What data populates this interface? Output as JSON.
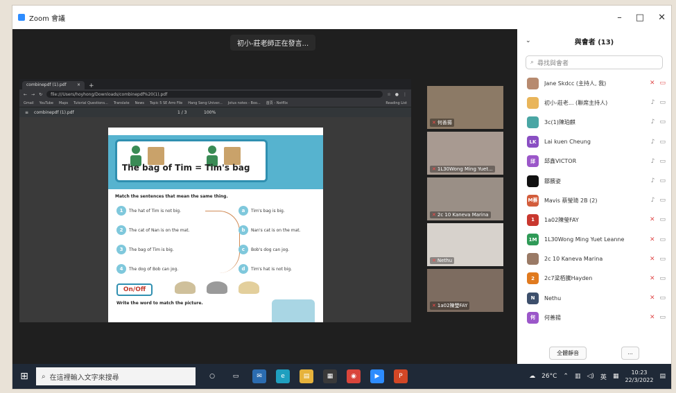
{
  "window": {
    "app_title": "Zoom 會議",
    "minimize": "–",
    "maximize": "□",
    "close": "✕"
  },
  "meeting": {
    "notice": "初小-莊老師正在發言..."
  },
  "browser": {
    "tab_title": "combinepdf (1).pdf",
    "tab_close": "×",
    "new_tab": "+",
    "url": "file:///Users/hoyhong/Downloads/combinepdf%20(1).pdf",
    "bookmarks": [
      "Gmail",
      "YouTube",
      "Maps",
      "Tutorial Questions...",
      "Translate",
      "News",
      "Topic 5 SE Arro File",
      "Hang Seng Univer...",
      "Jotus notes - Boo...",
      "首頁 - Netflix"
    ],
    "reading_list": "Reading List"
  },
  "pdf": {
    "file_name": "combinepdf (1).pdf",
    "page_indicator": "1 / 3",
    "zoom": "100%",
    "banner_title": "The bag of Tim = Tim's bag",
    "instruction": "Match the sentences that mean the same thing.",
    "left_sentences": [
      {
        "num": "1",
        "text": "The hat of Tim is not big."
      },
      {
        "num": "2",
        "text": "The cat of Nan is on the mat."
      },
      {
        "num": "3",
        "text": "The bag of Tim is big."
      },
      {
        "num": "4",
        "text": "The dog of Bob can jog."
      }
    ],
    "right_sentences": [
      {
        "num": "a",
        "text": "Tim's bag is big."
      },
      {
        "num": "b",
        "text": "Nan's cat is on the mat."
      },
      {
        "num": "c",
        "text": "Bob's dog can jog."
      },
      {
        "num": "d",
        "text": "Tim's hat is not big."
      }
    ],
    "onoff_label": "On/Off",
    "write_instruction": "Write the word to match the picture."
  },
  "video_tiles": [
    {
      "label": "何善揚",
      "bg": "#8c7a66"
    },
    {
      "label": "1L30Wong Ming Yuet...",
      "bg": "#a89a91"
    },
    {
      "label": "2c 10 Kaneva Marina",
      "bg": "#9a8f86"
    },
    {
      "label": "Nethu",
      "bg": "#d7d2cc"
    },
    {
      "label": "1a02陳瑩FAY",
      "bg": "#7d6c60"
    }
  ],
  "panel": {
    "title": "與會者 (13)",
    "collapse": "⌄",
    "search_placeholder": "尋找與會者",
    "mute_all": "全體靜音",
    "more": "..."
  },
  "participants": [
    {
      "name": "Jane Skdcc (主持人, 我)",
      "avatar": "",
      "color": "#b78a6f",
      "mic": "off",
      "cam": "off"
    },
    {
      "name": "初小-莊老... (聯席主持人)",
      "avatar": "",
      "color": "#e9b55a",
      "mic": "on",
      "cam": "on"
    },
    {
      "name": "3c(1)陳珀麒",
      "avatar": "",
      "color": "#4aa6a4",
      "mic": "on",
      "cam": "on"
    },
    {
      "name": "Lai kuen Cheung",
      "avatar": "LK",
      "color": "#8a4fc3",
      "mic": "on",
      "cam": "on"
    },
    {
      "name": "邱鑫VICTOR",
      "avatar": "邱",
      "color": "#9b57c9",
      "mic": "on",
      "cam": "on"
    },
    {
      "name": "鄒臏姿",
      "avatar": "",
      "color": "#111111",
      "mic": "on",
      "cam": "on"
    },
    {
      "name": "Mavis 蔡瑩琦 2B (2)",
      "avatar": "M蔡",
      "color": "#d35d3c",
      "mic": "on",
      "cam": "on"
    },
    {
      "name": "1a02陳瑩FAY",
      "avatar": "1",
      "color": "#c9382f",
      "mic": "off",
      "cam": "on"
    },
    {
      "name": "1L30Wong Ming Yuet Leanne",
      "avatar": "1M",
      "color": "#2f9a57",
      "mic": "off",
      "cam": "on"
    },
    {
      "name": "2c 10 Kaneva Marina",
      "avatar": "",
      "color": "#9a7a66",
      "mic": "off",
      "cam": "on"
    },
    {
      "name": "2c7梁栢騰Hayden",
      "avatar": "2",
      "color": "#e07a1f",
      "mic": "off",
      "cam": "on"
    },
    {
      "name": "Nethu",
      "avatar": "N",
      "color": "#3d4f6b",
      "mic": "off",
      "cam": "on"
    },
    {
      "name": "何善揚",
      "avatar": "何",
      "color": "#9b57c9",
      "mic": "off",
      "cam": "on"
    }
  ],
  "taskbar": {
    "start": "⊞",
    "search_placeholder": "在這裡輸入文字來搜尋",
    "weather": "26°C",
    "ime": "英",
    "time": "10:23",
    "date": "22/3/2022"
  }
}
